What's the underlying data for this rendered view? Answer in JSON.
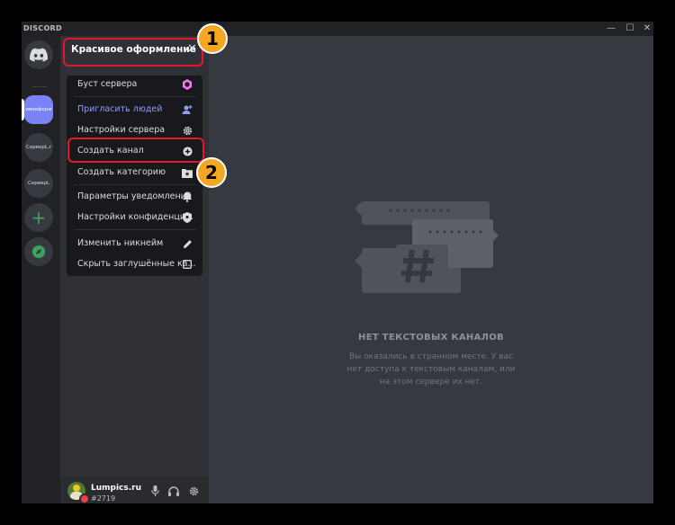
{
  "app": {
    "brand": "DISCORD"
  },
  "window_controls": {
    "minimize": "—",
    "maximize": "☐",
    "close": "✕"
  },
  "guilds": [
    {
      "label": "",
      "icon": "discord-home-icon"
    },
    {
      "label": "ивоеформ",
      "selected": true
    },
    {
      "label": "СерверL.r"
    },
    {
      "label": "СерверL"
    },
    {
      "label": "+",
      "icon": "add-server-icon"
    },
    {
      "label": "",
      "icon": "explore-compass-icon"
    }
  ],
  "menu": {
    "title": "Красивое оформление",
    "items": [
      {
        "label": "Буст сервера",
        "icon": "boost-gem-icon"
      },
      {
        "label": "Пригласить людей",
        "icon": "invite-people-icon",
        "accent": true
      },
      {
        "label": "Настройки сервера",
        "icon": "gear-icon"
      },
      {
        "label": "Создать канал",
        "icon": "plus-circle-icon"
      },
      {
        "label": "Создать категорию",
        "icon": "folder-plus-icon"
      },
      {
        "label": "Параметры уведомлений",
        "icon": "bell-icon"
      },
      {
        "label": "Настройки конфиденци...",
        "icon": "shield-icon"
      },
      {
        "label": "Изменить никнейм",
        "icon": "pencil-icon"
      },
      {
        "label": "Скрыть заглушённые ка...",
        "icon": "checkbox-icon"
      }
    ]
  },
  "callouts": {
    "one": "1",
    "two": "2"
  },
  "user": {
    "name": "Lumpics.ru",
    "tag": "#2719"
  },
  "empty_state": {
    "title": "НЕТ ТЕКСТОВЫХ КАНАЛОВ",
    "subtitle": "Вы оказались в странном месте. У вас нет доступа к текстовым каналам, или на этом сервере их нет."
  },
  "colors": {
    "accent": "#7983f5",
    "highlight": "#e8142a",
    "badge": "#f5a623",
    "boost": "#ff73fa"
  }
}
